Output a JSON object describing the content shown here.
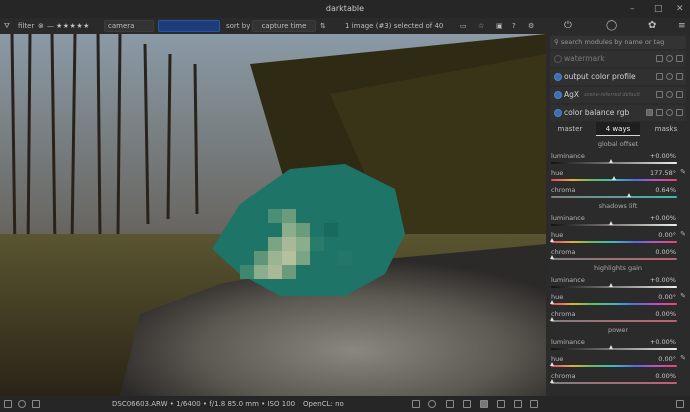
{
  "window": {
    "title": "darktable"
  },
  "filterbar": {
    "filter_label": "filter",
    "rating_stars": "★★★★★",
    "camera_label": "camera",
    "sort_label": "sort by",
    "sort_value": "capture time",
    "count_text": "1 image (#3) selected of 40"
  },
  "right_top": {
    "icons": [
      "power-icon",
      "circle-icon",
      "palette-icon",
      "hamburger-icon"
    ]
  },
  "panel": {
    "search_placeholder": "search modules by name or tag",
    "modules": [
      {
        "name": "watermark",
        "enabled": false
      },
      {
        "name": "output color profile",
        "enabled": true
      },
      {
        "name": "AgX",
        "subtitle": "scene-referred default",
        "enabled": true
      },
      {
        "name": "color balance rgb",
        "enabled": true
      }
    ],
    "tabs": [
      "master",
      "4 ways",
      "masks"
    ],
    "active_tab": "4 ways",
    "sections": [
      {
        "title": "global offset",
        "rows": [
          {
            "label": "luminance",
            "value": "+0.00%"
          },
          {
            "label": "hue",
            "value": "177.58°"
          },
          {
            "label": "chroma",
            "value": "0.64%"
          }
        ]
      },
      {
        "title": "shadows lift",
        "rows": [
          {
            "label": "luminance",
            "value": "+0.00%"
          },
          {
            "label": "hue",
            "value": "0.00°"
          },
          {
            "label": "chroma",
            "value": "0.00%"
          }
        ]
      },
      {
        "title": "highlights gain",
        "rows": [
          {
            "label": "luminance",
            "value": "+0.00%"
          },
          {
            "label": "hue",
            "value": "0.00°"
          },
          {
            "label": "chroma",
            "value": "0.00%"
          }
        ]
      },
      {
        "title": "power",
        "rows": [
          {
            "label": "luminance",
            "value": "+0.00%"
          },
          {
            "label": "hue",
            "value": "0.00°"
          },
          {
            "label": "chroma",
            "value": "0.00%"
          }
        ]
      }
    ]
  },
  "status": {
    "image_info": "DSC06603.ARW • 1/6400 • f/1.8 85.0 mm • ISO 100",
    "opencl": "OpenCL: no"
  },
  "colors": {
    "accent": "#3d6fb0",
    "teal_blob": "#1f7a6e"
  }
}
